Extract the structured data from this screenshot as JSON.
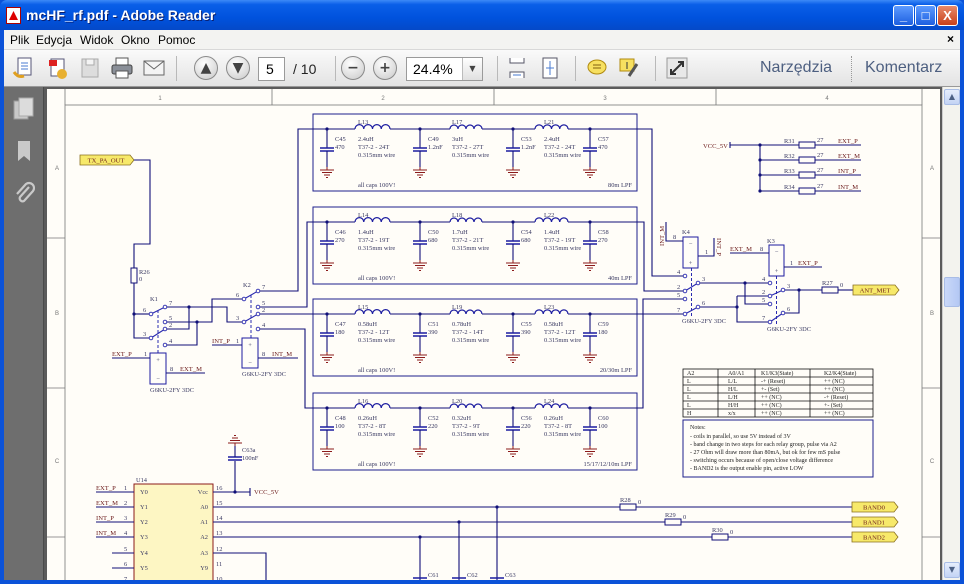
{
  "window": {
    "title": "mcHF_rf.pdf - Adobe Reader",
    "minimize": "_",
    "maximize": "□",
    "close": "X"
  },
  "menu": {
    "items": [
      "Plik",
      "Edycja",
      "Widok",
      "Okno",
      "Pomoc"
    ],
    "close": "×"
  },
  "toolbar": {
    "page_current": "5",
    "page_total": "/ 10",
    "zoom": "24.4%",
    "tools_label": "Narzędzia",
    "comment_label": "Komentarz",
    "icons": [
      "create-pdf-icon",
      "export-icon",
      "save-icon",
      "print-icon",
      "email-icon",
      "page-up-icon",
      "page-down-icon",
      "zoom-out-icon",
      "zoom-in-icon",
      "scroll-mode-icon",
      "fit-page-icon",
      "comment-icon",
      "highlight-icon",
      "fullscreen-icon"
    ]
  },
  "sidebar": {
    "icons": [
      "pages-icon",
      "bookmarks-icon",
      "attachments-icon"
    ]
  },
  "schematic": {
    "zones_top": [
      "1",
      "2",
      "3",
      "4"
    ],
    "zones_side": [
      "A",
      "B",
      "C"
    ],
    "filters": [
      {
        "name": "80m LPF",
        "note": "all caps 100V!",
        "caps": [
          {
            "ref": "C45",
            "val": "470"
          },
          {
            "ref": "C49",
            "val": "1.2nF"
          },
          {
            "ref": "C53",
            "val": "1.2nF"
          },
          {
            "ref": "C57",
            "val": "470"
          }
        ],
        "inductors": [
          {
            "ref": "L13",
            "val": "2.4uH",
            "core": "T37-2 - 24T",
            "wire": "0.315mm wire"
          },
          {
            "ref": "L17",
            "val": "3uH",
            "core": "T37-2 - 27T",
            "wire": "0.315mm wire"
          },
          {
            "ref": "L21",
            "val": "2.4uH",
            "core": "T37-2 - 24T",
            "wire": "0.315mm wire"
          }
        ]
      },
      {
        "name": "40m LPF",
        "note": "all caps 100V!",
        "caps": [
          {
            "ref": "C46",
            "val": "270"
          },
          {
            "ref": "C50",
            "val": "680"
          },
          {
            "ref": "C54",
            "val": "680"
          },
          {
            "ref": "C58",
            "val": "270"
          }
        ],
        "inductors": [
          {
            "ref": "L14",
            "val": "1.4uH",
            "core": "T37-2 - 19T",
            "wire": "0.315mm wire"
          },
          {
            "ref": "L18",
            "val": "1.7uH",
            "core": "T37-2 - 21T",
            "wire": "0.315mm wire"
          },
          {
            "ref": "L22",
            "val": "1.4uH",
            "core": "T37-2 - 19T",
            "wire": "0.315mm wire"
          }
        ]
      },
      {
        "name": "20/30m LPF",
        "note": "all caps 100V!",
        "caps": [
          {
            "ref": "C47",
            "val": "180"
          },
          {
            "ref": "C51",
            "val": "390"
          },
          {
            "ref": "C55",
            "val": "390"
          },
          {
            "ref": "C59",
            "val": "180"
          }
        ],
        "inductors": [
          {
            "ref": "L15",
            "val": "0.58uH",
            "core": "T37-2 - 12T",
            "wire": "0.315mm wire"
          },
          {
            "ref": "L19",
            "val": "0.78uH",
            "core": "T37-2 - 14T",
            "wire": "0.315mm wire"
          },
          {
            "ref": "L23",
            "val": "0.58uH",
            "core": "T37-2 - 12T",
            "wire": "0.315mm wire"
          }
        ]
      },
      {
        "name": "15/17/12/10m LPF",
        "note": "all caps 100V!",
        "caps": [
          {
            "ref": "C48",
            "val": "100"
          },
          {
            "ref": "C52",
            "val": "220"
          },
          {
            "ref": "C56",
            "val": "220"
          },
          {
            "ref": "C60",
            "val": "100"
          }
        ],
        "inductors": [
          {
            "ref": "L16",
            "val": "0.26uH",
            "core": "T37-2 - 8T",
            "wire": "0.315mm wire"
          },
          {
            "ref": "L20",
            "val": "0.32uH",
            "core": "T37-2 - 9T",
            "wire": "0.315mm wire"
          },
          {
            "ref": "L24",
            "val": "0.26uH",
            "core": "T37-2 - 8T",
            "wire": "0.315mm wire"
          }
        ]
      }
    ],
    "nets": {
      "tx_pa_out": "TX_PA_OUT",
      "ant_met": "ANT_MET",
      "vcc": "VCC_5V",
      "ext_p": "EXT_P",
      "ext_m": "EXT_M",
      "int_p": "INT_P",
      "int_m": "INT_M"
    },
    "relays": [
      {
        "ref": "K1",
        "part": "G6KU-2FY 3DC",
        "pins": [
          "6",
          "3",
          "7",
          "5",
          "2",
          "4",
          "1",
          "8"
        ]
      },
      {
        "ref": "K2",
        "part": "G6KU-2FY 3DC",
        "pins": [
          "6",
          "3",
          "7",
          "5",
          "2",
          "4",
          "1",
          "8"
        ]
      },
      {
        "ref": "K3",
        "part": "G6KU-2FY 3DC",
        "pins": [
          "3",
          "6",
          "4",
          "2",
          "5",
          "7",
          "8",
          "1"
        ]
      },
      {
        "ref": "K4",
        "part": "G6KU-2FY 3DC",
        "pins": [
          "3",
          "6",
          "4",
          "2",
          "5",
          "7",
          "8",
          "1"
        ]
      }
    ],
    "coil_signs": {
      "plus": "+",
      "minus": "−"
    },
    "r26": {
      "ref": "R26",
      "val": "0"
    },
    "r27": {
      "ref": "R27",
      "val": "0"
    },
    "pullups": [
      {
        "ref": "R31",
        "val": "27",
        "net": "EXT_P"
      },
      {
        "ref": "R32",
        "val": "27",
        "net": "EXT_M"
      },
      {
        "ref": "R33",
        "val": "27",
        "net": "INT_P"
      },
      {
        "ref": "R34",
        "val": "27",
        "net": "INT_M"
      }
    ],
    "u14": {
      "ref": "U14",
      "left": [
        {
          "num": "1",
          "name": "Y0",
          "net": "EXT_P"
        },
        {
          "num": "2",
          "name": "Y1",
          "net": "EXT_M"
        },
        {
          "num": "3",
          "name": "Y2",
          "net": "INT_P"
        },
        {
          "num": "4",
          "name": "Y3",
          "net": "INT_M"
        },
        {
          "num": "5",
          "name": "Y4",
          "net": ""
        },
        {
          "num": "6",
          "name": "Y5",
          "net": ""
        },
        {
          "num": "7",
          "name": "",
          "net": ""
        }
      ],
      "right": [
        {
          "num": "16",
          "name": "Vcc"
        },
        {
          "num": "15",
          "name": "A0"
        },
        {
          "num": "14",
          "name": "A1"
        },
        {
          "num": "13",
          "name": "A2"
        },
        {
          "num": "12",
          "name": "A3"
        },
        {
          "num": "11",
          "name": "Y9"
        },
        {
          "num": "10",
          "name": ""
        }
      ]
    },
    "c63a": {
      "ref": "C63a",
      "val": "100nF"
    },
    "band_resistors": [
      {
        "ref": "R28",
        "val": "0"
      },
      {
        "ref": "R29",
        "val": "0"
      },
      {
        "ref": "R30",
        "val": "0"
      }
    ],
    "bands": [
      "BAND0",
      "BAND1",
      "BAND2"
    ],
    "bottom_caps": [
      {
        "ref": "C61",
        "val": "100nF"
      },
      {
        "ref": "C62",
        "val": "100nF"
      },
      {
        "ref": "C63",
        "val": "100nF"
      }
    ],
    "truth_table": {
      "headers": [
        "A2",
        "A0/A1",
        "K1/K3(State)",
        "K2/K4(State)"
      ],
      "rows": [
        [
          "L",
          "L/L",
          "-+ (Reset)",
          "++ (NC)"
        ],
        [
          "L",
          "H/L",
          "+- (Set)",
          "++ (NC)"
        ],
        [
          "L",
          "L/H",
          "++ (NC)",
          "-+ (Reset)"
        ],
        [
          "L",
          "H/H",
          "++ (NC)",
          "+- (Set)"
        ],
        [
          "H",
          "x/x",
          "++ (NC)",
          "++ (NC)"
        ]
      ]
    },
    "notes": {
      "title": "Notes:",
      "lines": [
        "- coils in parallel, so use 5V instead of 3V",
        "- band change in two steps for each relay group, pulse via A2",
        "- 27 Ohm will draw more than 80mA, but ok for few mS pulse",
        "- switching occurs because of open/close voltage difference",
        "- BAND2 is the output enable pin, active LOW"
      ]
    }
  }
}
